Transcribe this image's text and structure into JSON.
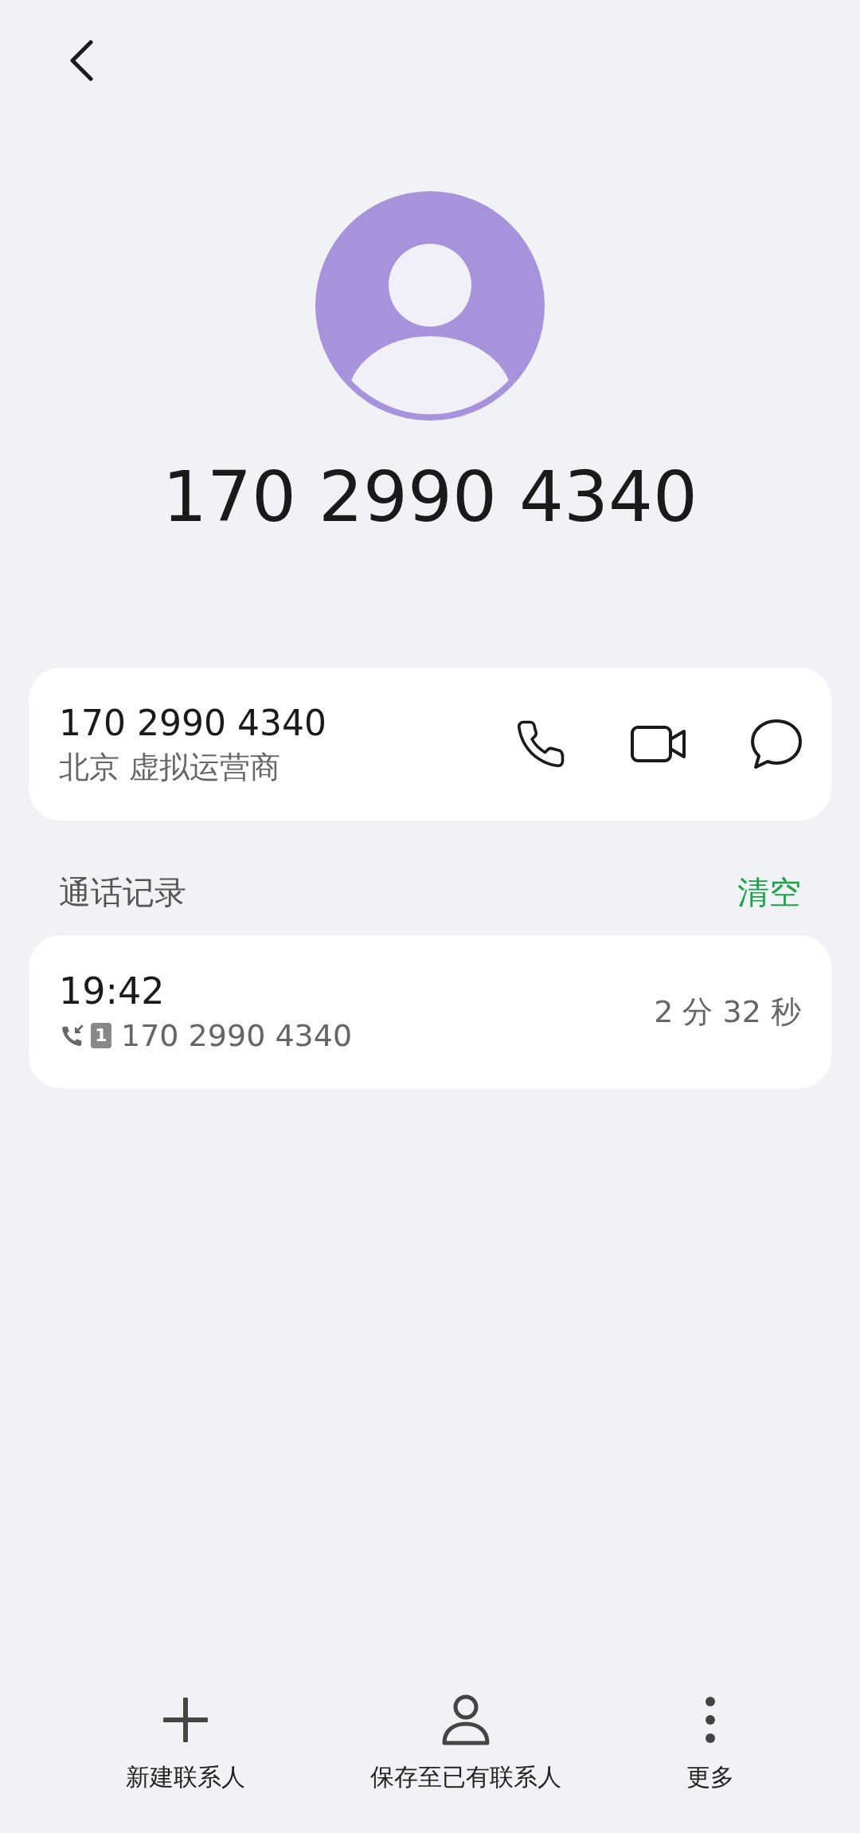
{
  "title_number": "170 2990 4340",
  "number_card": {
    "number": "170 2990 4340",
    "location": "北京 虚拟运营商"
  },
  "call_log": {
    "heading": "通话记录",
    "clear": "清空",
    "entries": [
      {
        "time": "19:42",
        "sim": "1",
        "number": "170 2990 4340",
        "duration": "2 分 32 秒"
      }
    ]
  },
  "bottom_actions": [
    {
      "kind": "add",
      "label": "新建联系人"
    },
    {
      "kind": "person",
      "label": "保存至已有联系人"
    },
    {
      "kind": "more",
      "label": "更多"
    }
  ]
}
